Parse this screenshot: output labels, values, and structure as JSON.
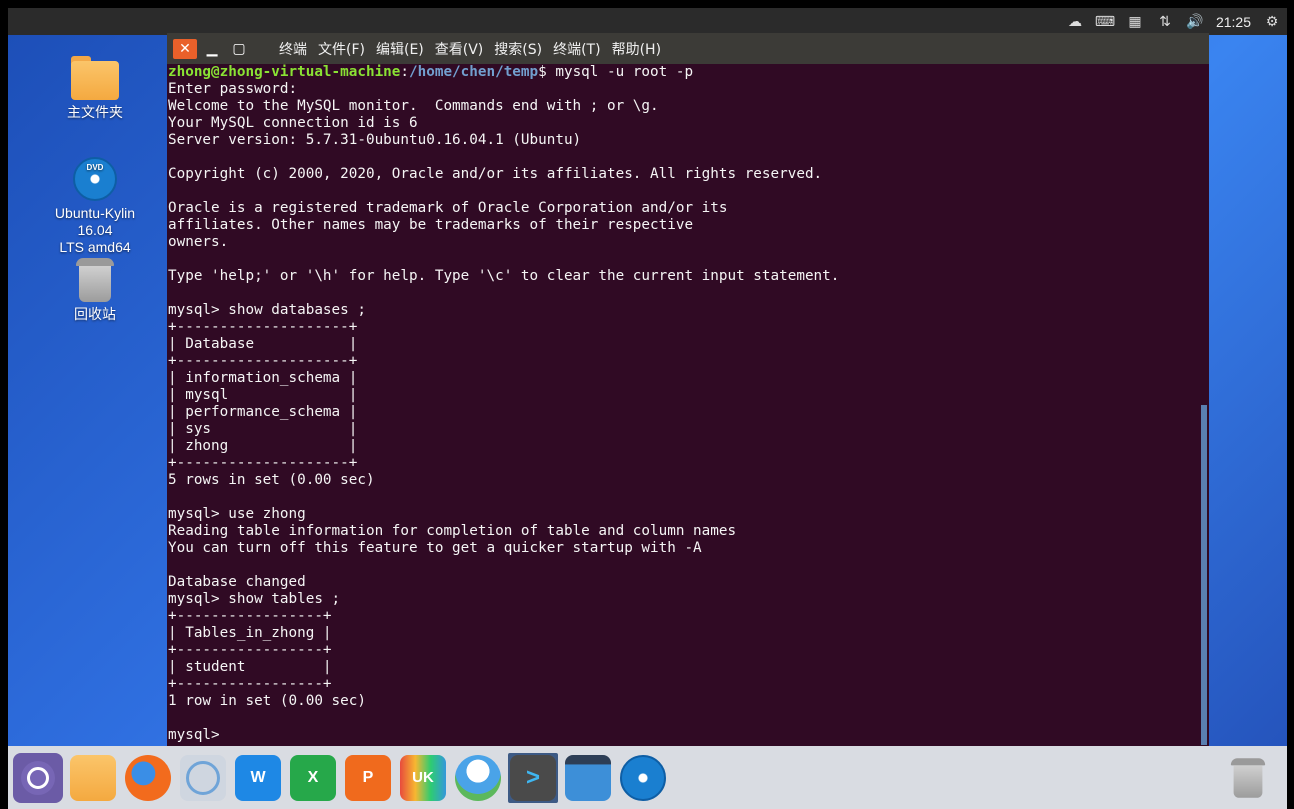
{
  "topbar": {
    "clock": "21:25",
    "icons": [
      "weather-icon",
      "keyboard-icon",
      "calendar-icon",
      "network-icon",
      "volume-icon",
      "settings-icon"
    ]
  },
  "desktop": {
    "icons": [
      {
        "name": "home-folder",
        "label": "主文件夹"
      },
      {
        "name": "dvd",
        "label": "Ubuntu-Kylin 16.04\nLTS amd64"
      },
      {
        "name": "trash",
        "label": "回收站"
      }
    ]
  },
  "terminal": {
    "menu": [
      "终端",
      "文件(F)",
      "编辑(E)",
      "查看(V)",
      "搜索(S)",
      "终端(T)",
      "帮助(H)"
    ],
    "prompt_user": "zhong@zhong-virtual-machine",
    "prompt_sep": ":",
    "prompt_path": "/home/chen/temp",
    "prompt_cmd": "$ mysql -u root -p",
    "output": "Enter password: \nWelcome to the MySQL monitor.  Commands end with ; or \\g.\nYour MySQL connection id is 6\nServer version: 5.7.31-0ubuntu0.16.04.1 (Ubuntu)\n\nCopyright (c) 2000, 2020, Oracle and/or its affiliates. All rights reserved.\n\nOracle is a registered trademark of Oracle Corporation and/or its\naffiliates. Other names may be trademarks of their respective\nowners.\n\nType 'help;' or '\\h' for help. Type '\\c' to clear the current input statement.\n\nmysql> show databases ;\n+--------------------+\n| Database           |\n+--------------------+\n| information_schema |\n| mysql              |\n| performance_schema |\n| sys                |\n| zhong              |\n+--------------------+\n5 rows in set (0.00 sec)\n\nmysql> use zhong\nReading table information for completion of table and column names\nYou can turn off this feature to get a quicker startup with -A\n\nDatabase changed\nmysql> show tables ;\n+-----------------+\n| Tables_in_zhong |\n+-----------------+\n| student         |\n+-----------------+\n1 row in set (0.00 sec)\n\nmysql> "
  },
  "dock": {
    "items": [
      {
        "name": "kylin-start-icon",
        "label": ""
      },
      {
        "name": "files-icon",
        "label": ""
      },
      {
        "name": "firefox-icon",
        "label": ""
      },
      {
        "name": "browser-icon",
        "label": ""
      },
      {
        "name": "writer-icon",
        "label": "W"
      },
      {
        "name": "spreadsheet-icon",
        "label": "X"
      },
      {
        "name": "presentation-icon",
        "label": "P"
      },
      {
        "name": "software-center-icon",
        "label": "UK"
      },
      {
        "name": "assistant-icon",
        "label": ""
      },
      {
        "name": "terminal-icon",
        "label": ">"
      },
      {
        "name": "workspace-icon",
        "label": ""
      },
      {
        "name": "dvd-icon",
        "label": ""
      }
    ],
    "trash_icon": "trash-icon"
  }
}
